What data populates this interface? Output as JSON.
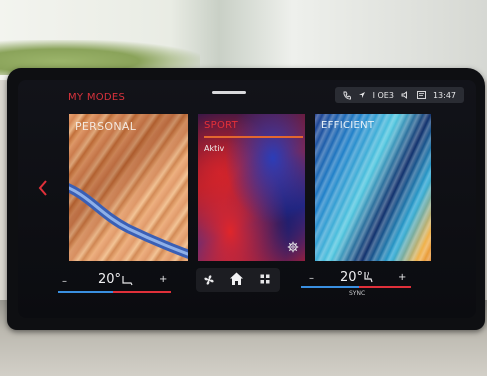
{
  "screen": {
    "title": "MY MODES",
    "status": {
      "signal_text": "I OE3",
      "time": "13:47"
    },
    "modes": [
      {
        "label": "PERSONAL",
        "selected": false
      },
      {
        "label": "SPORT",
        "selected": true,
        "status": "Aktiv"
      },
      {
        "label": "EFFICIENT",
        "selected": false
      }
    ],
    "climate": {
      "left": {
        "minus": "–",
        "temp": "20°",
        "plus": "+"
      },
      "right": {
        "minus": "–",
        "temp": "20°",
        "plus": "+",
        "sync_label": "SYNC"
      }
    },
    "icons": {
      "back": "chevron-left-icon",
      "fan": "fan-icon",
      "home": "home-icon",
      "apps": "apps-grid-icon",
      "seat": "seat-heater-icon",
      "settings": "gear-icon"
    },
    "colors": {
      "accent_red": "#d8323c",
      "accent_orange": "#e3672f",
      "blue": "#3a8fe0"
    }
  }
}
